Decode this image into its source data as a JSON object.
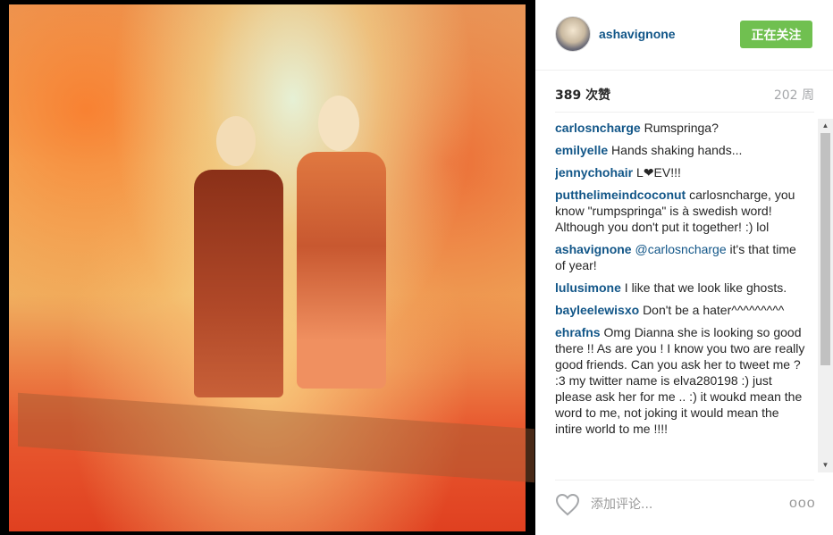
{
  "post": {
    "image_alt": "Polaroid of two women holding hands in a sunlit field"
  },
  "header": {
    "username": "ashavignone",
    "follow_label": "正在关注"
  },
  "stats": {
    "likes": "389 次赞",
    "age": "202 周"
  },
  "comments": [
    {
      "user": "carlosncharge",
      "text": "Rumspringa?"
    },
    {
      "user": "emilyelle",
      "text": "Hands shaking hands..."
    },
    {
      "user": "jennychohair",
      "text": "L❤EV!!!"
    },
    {
      "user": "putthelimeindcoconut",
      "text": "carlosncharge, you know \"rumpspringa\" is à swedish word! Although you don't put it together! :) lol"
    },
    {
      "user": "ashavignone",
      "mention": "@carlosncharge",
      "text": "it's that time of year!"
    },
    {
      "user": "lulusimone",
      "text": "I like that we look like ghosts."
    },
    {
      "user": "bayleelewisxo",
      "text": "Don't be a hater^^^^^^^^^"
    },
    {
      "user": "ehrafns",
      "text": "Omg Dianna she is looking so good there !! As are you ! I know you two are really good friends. Can you ask her to tweet me ? :3 my twitter name is elva280198 :) just please ask her for me .. :) it woukd mean the word to me, not joking it would mean the intire world to me !!!!"
    }
  ],
  "footer": {
    "comment_placeholder": "添加评论...",
    "more_label": "ooo"
  }
}
